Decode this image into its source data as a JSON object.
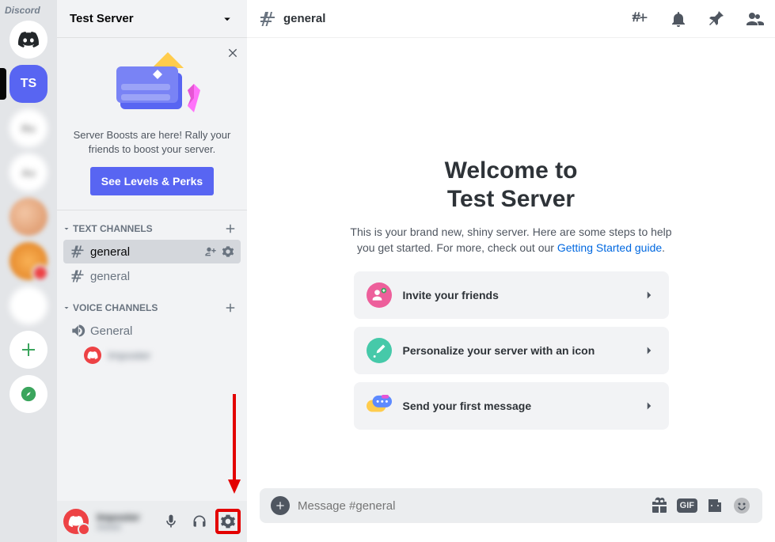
{
  "app_name": "Discord",
  "servers": {
    "selected_initials": "TS",
    "blurred": [
      "Ro",
      "Ao",
      ""
    ]
  },
  "server_header": {
    "name": "Test Server"
  },
  "boost": {
    "text": "Server Boosts are here! Rally your friends to boost your server.",
    "button": "See Levels & Perks"
  },
  "categories": {
    "text": {
      "label": "TEXT CHANNELS"
    },
    "voice": {
      "label": "VOICE CHANNELS"
    }
  },
  "channels": {
    "text": [
      {
        "name": "general",
        "selected": true
      },
      {
        "name": "general",
        "selected": false
      }
    ],
    "voice": [
      {
        "name": "General"
      }
    ],
    "voice_user": "Imposter"
  },
  "user_area": {
    "name": "Imposter",
    "tag": "#0000"
  },
  "chat_header": {
    "channel": "general"
  },
  "welcome": {
    "title_line1": "Welcome to",
    "title_line2": "Test Server",
    "sub_pre": "This is your brand new, shiny server. Here are some steps to help you get started. For more, check out our ",
    "sub_link": "Getting Started guide",
    "sub_post": ".",
    "cards": [
      {
        "label": "Invite your friends"
      },
      {
        "label": "Personalize your server with an icon"
      },
      {
        "label": "Send your first message"
      }
    ]
  },
  "composer": {
    "placeholder": "Message #general",
    "gif": "GIF"
  }
}
